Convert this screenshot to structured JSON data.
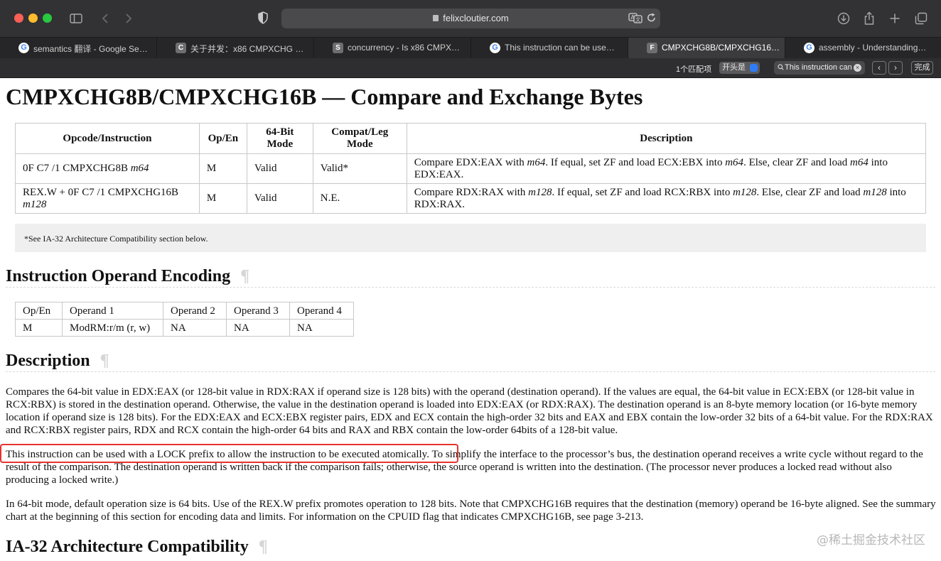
{
  "browser": {
    "url": "felixcloutier.com",
    "tabs": [
      {
        "favicon": "G",
        "label": "semantics 翻译 - Google Se…"
      },
      {
        "favicon": "C",
        "label": "关于并发：x86 CMPXCHG …"
      },
      {
        "favicon": "S",
        "label": "concurrency - Is x86 CMPX…"
      },
      {
        "favicon": "G",
        "label": "This instruction can be use…"
      },
      {
        "favicon": "F",
        "label": "CMPXCHG8B/CMPXCHG16…"
      },
      {
        "favicon": "G",
        "label": "assembly - Understanding…"
      }
    ],
    "active_tab": 4
  },
  "findbar": {
    "match_count": "1个匹配项",
    "mode": "开头是",
    "query": "This instruction can",
    "done_label": "完成"
  },
  "page": {
    "title": "CMPXCHG8B/CMPXCHG16B — Compare and Exchange Bytes",
    "opcode_table": {
      "headers": [
        "Opcode/Instruction",
        "Op/En",
        "64-Bit Mode",
        "Compat/Leg Mode",
        "Description"
      ],
      "rows": [
        {
          "opcode_pre": "0F C7 /1 CMPXCHG8B ",
          "opcode_italic": "m64",
          "open": "M",
          "mode64": "Valid",
          "compat": "Valid*",
          "desc": [
            "Compare EDX:EAX with ",
            "m64",
            ". If equal, set ZF and load ECX:EBX into ",
            "m64",
            ". Else, clear ZF and load ",
            "m64",
            " into EDX:EAX."
          ]
        },
        {
          "opcode_pre": "REX.W + 0F C7 /1 CMPXCHG16B ",
          "opcode_italic": "m128",
          "open": "M",
          "mode64": "Valid",
          "compat": "N.E.",
          "desc": [
            "Compare RDX:RAX with ",
            "m128",
            ". If equal, set ZF and load RCX:RBX into ",
            "m128",
            ". Else, clear ZF and load ",
            "m128",
            " into RDX:RAX."
          ]
        }
      ]
    },
    "footnote": "*See IA-32 Architecture Compatibility section below.",
    "encoding_heading": "Instruction Operand Encoding",
    "operand_table": {
      "headers": [
        "Op/En",
        "Operand 1",
        "Operand 2",
        "Operand 3",
        "Operand 4"
      ],
      "row": [
        "M",
        "ModRM:r/m (r, w)",
        "NA",
        "NA",
        "NA"
      ]
    },
    "description_heading": "Description",
    "paragraphs": {
      "p1": "Compares the 64-bit value in EDX:EAX (or 128-bit value in RDX:RAX if operand size is 128 bits) with the operand (destination operand). If the values are equal, the 64-bit value in ECX:EBX (or 128-bit value in RCX:RBX) is stored in the destination operand. Otherwise, the value in the destination operand is loaded into EDX:EAX (or RDX:RAX). The destination operand is an 8-byte memory location (or 16-byte memory location if operand size is 128 bits). For the EDX:EAX and ECX:EBX register pairs, EDX and ECX contain the high-order 32 bits and EAX and EBX contain the low-order 32 bits of a 64-bit value. For the RDX:RAX and RCX:RBX register pairs, RDX and RCX contain the high-order 64 bits and RAX and RBX contain the low-order 64bits of a 128-bit value.",
      "p2_highlight": "This instruction can be used with a LOCK prefix to allow the instruction to be executed atomically.",
      "p2_rest": " To simplify the interface to the processor’s bus, the destination operand receives a write cycle without regard to the result of the comparison. The destination operand is written back if the comparison fails; otherwise, the source operand is written into the destination. (The processor never produces a locked read without also producing a locked write.)",
      "p3": "In 64-bit mode, default operation size is 64 bits. Use of the REX.W prefix promotes operation to 128 bits. Note that CMPXCHG16B requires that the destination (memory) operand be 16-byte aligned. See the summary chart at the beginning of this section for encoding data and limits. For information on the CPUID flag that indicates CMPXCHG16B, see page 3-213."
    },
    "compat_heading": "IA-32 Architecture Compatibility",
    "pilcrow": "¶",
    "watermark": "@稀土掘金技术社区"
  },
  "colors": {
    "chrome": "#323234",
    "tabbar": "#262628",
    "active_tab": "#3b3b3d",
    "highlight_box": "#e8332f",
    "footnote_bg": "#efefef"
  }
}
